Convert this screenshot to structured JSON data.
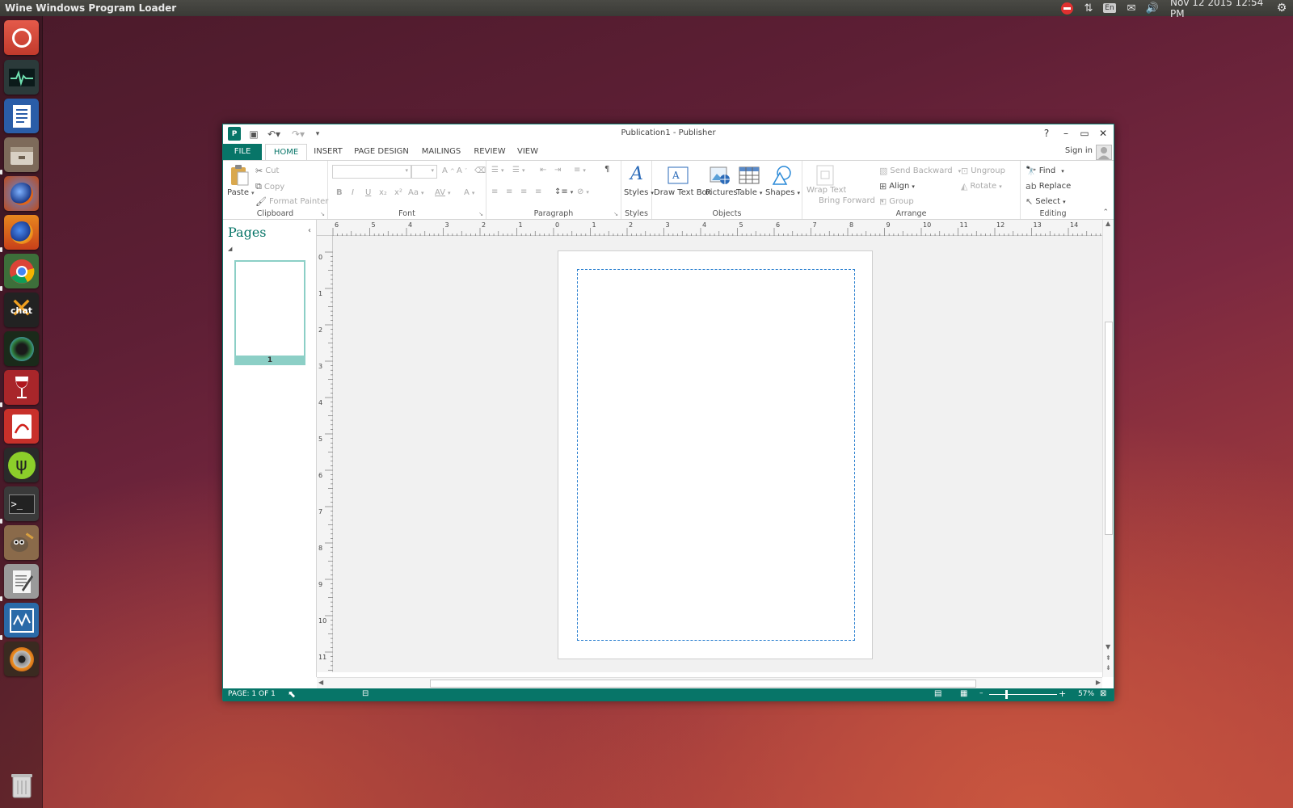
{
  "topbar": {
    "app_title": "Wine Windows Program Loader",
    "keyboard_layout": "En",
    "clock": "Nov 12 2015 12:54 PM"
  },
  "launcher": {
    "items": [
      "ubuntu-dash-icon",
      "system-monitor-icon",
      "libreoffice-writer-icon",
      "files-icon",
      "firefox-dev-icon",
      "firefox-icon",
      "chrome-icon",
      "xchat-icon",
      "vlc-icon",
      "wine-icon",
      "evince-icon",
      "usb-creator-icon",
      "terminal-icon",
      "gimp-icon",
      "text-editor-icon",
      "workspace-icon",
      "disk-burner-icon",
      "trash-icon"
    ],
    "xchat_label": "chat"
  },
  "window": {
    "title": "Publication1 - Publisher",
    "help": "?",
    "sign_in": "Sign in",
    "tabs": [
      "FILE",
      "HOME",
      "INSERT",
      "PAGE DESIGN",
      "MAILINGS",
      "REVIEW",
      "VIEW"
    ],
    "active_tab": "HOME"
  },
  "ribbon": {
    "clipboard": {
      "label": "Clipboard",
      "paste": "Paste",
      "cut": "Cut",
      "copy": "Copy",
      "format_painter": "Format Painter"
    },
    "font": {
      "label": "Font",
      "bold": "B",
      "italic": "I",
      "underline": "U",
      "subscript": "x₂",
      "superscript": "x²",
      "change_case": "Aa",
      "spacing": "AV",
      "font_color": "A"
    },
    "paragraph": {
      "label": "Paragraph",
      "show_marks": "¶"
    },
    "styles": {
      "label": "Styles",
      "styles": "Styles"
    },
    "objects": {
      "label": "Objects",
      "draw_text_box": "Draw Text Box",
      "pictures": "Pictures",
      "table": "Table",
      "shapes": "Shapes"
    },
    "arrange": {
      "label": "Arrange",
      "wrap_text": "Wrap Text",
      "send_backward": "Send Backward",
      "bring_forward": "Bring Forward",
      "align": "Align",
      "group": "Group",
      "ungroup": "Ungroup",
      "rotate": "Rotate"
    },
    "editing": {
      "label": "Editing",
      "find": "Find",
      "replace": "Replace",
      "select": "Select"
    }
  },
  "pages_pane": {
    "title": "Pages",
    "page_number": "1"
  },
  "rulers": {
    "horizontal": [
      "6",
      "5",
      "4",
      "3",
      "2",
      "1",
      "0",
      "1",
      "2",
      "3",
      "4",
      "5",
      "6",
      "7",
      "8",
      "9",
      "10",
      "11",
      "12",
      "13",
      "14"
    ],
    "vertical": [
      "0",
      "1",
      "2",
      "3",
      "4",
      "5",
      "6",
      "7",
      "8",
      "9",
      "10",
      "11"
    ]
  },
  "status": {
    "page": "PAGE: 1 OF 1",
    "zoom": "57%"
  },
  "colors": {
    "accent": "#077568",
    "margin_guide": "#2a7fcf"
  }
}
